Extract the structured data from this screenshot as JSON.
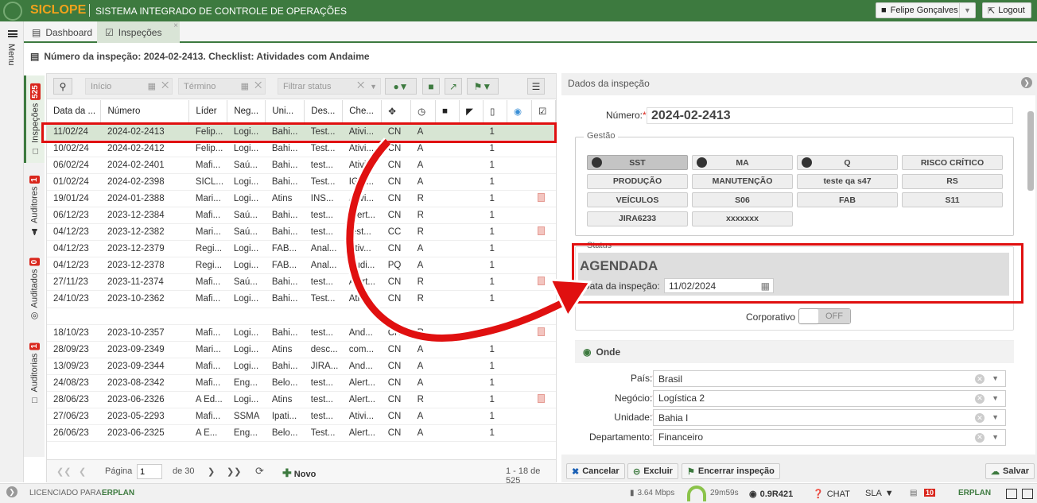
{
  "app": {
    "brand": "SICLOPE",
    "subtitle": "SISTEMA INTEGRADO DE CONTROLE DE OPERAÇÕES",
    "user": "Felipe Gonçalves",
    "logout": "Logout",
    "menu": "Menu"
  },
  "tabs": [
    {
      "label": "Dashboard"
    },
    {
      "label": "Inspeções",
      "close": "×"
    }
  ],
  "breadcrumb": "Número da inspeção: 2024-02-2413. Checklist: Atividades com Andaime",
  "vtabs": [
    {
      "label": "Inspeções",
      "count": "525"
    },
    {
      "label": "Auditores",
      "count": "1"
    },
    {
      "label": "Auditados",
      "count": "0"
    },
    {
      "label": "Auditorias",
      "count": "1"
    }
  ],
  "filters": {
    "start": "Início",
    "end": "Término",
    "status": "Filtrar status"
  },
  "table": {
    "headers": [
      "Data da ...",
      "Número",
      "Líder",
      "Neg...",
      "Uni...",
      "Des...",
      "Che..."
    ],
    "rows": [
      [
        "11/02/24",
        "2024-02-2413",
        "Felip...",
        "Logi...",
        "Bahi...",
        "Test...",
        "Ativi...",
        "CN",
        "A",
        "1"
      ],
      [
        "10/02/24",
        "2024-02-2412",
        "Felip...",
        "Logi...",
        "Bahi...",
        "Test...",
        "Ativi...",
        "CN",
        "A",
        "1"
      ],
      [
        "06/02/24",
        "2024-02-2401",
        "Mafi...",
        "Saú...",
        "Bahi...",
        "test...",
        "Ativi...",
        "CN",
        "A",
        "1"
      ],
      [
        "01/02/24",
        "2024-02-2398",
        "SICL...",
        "Logi...",
        "Bahi...",
        "Test...",
        "IG 7...",
        "CN",
        "A",
        "1"
      ],
      [
        "19/01/24",
        "2024-01-2388",
        "Mari...",
        "Logi...",
        "Atins",
        "INS...",
        "Ativi...",
        "CN",
        "R",
        "1"
      ],
      [
        "06/12/23",
        "2023-12-2384",
        "Mafi...",
        "Saú...",
        "Bahi...",
        "test...",
        "Alert...",
        "CN",
        "R",
        "1"
      ],
      [
        "04/12/23",
        "2023-12-2382",
        "Mari...",
        "Saú...",
        "Bahi...",
        "test...",
        "test...",
        "CC",
        "R",
        "1"
      ],
      [
        "04/12/23",
        "2023-12-2379",
        "Regi...",
        "Logi...",
        "FAB...",
        "Anal...",
        "Ativ...",
        "CN",
        "A",
        "1"
      ],
      [
        "04/12/23",
        "2023-12-2378",
        "Regi...",
        "Logi...",
        "FAB...",
        "Anal...",
        "Audi...",
        "PQ",
        "A",
        "1"
      ],
      [
        "27/11/23",
        "2023-11-2374",
        "Mafi...",
        "Saú...",
        "Bahi...",
        "test...",
        "Alert...",
        "CN",
        "R",
        "1"
      ],
      [
        "24/10/23",
        "2023-10-2362",
        "Mafi...",
        "Logi...",
        "Bahi...",
        "Test...",
        "Ativi...",
        "CN",
        "R",
        "1"
      ],
      [
        "",
        "",
        "",
        "",
        "",
        "",
        "",
        "",
        "",
        ""
      ],
      [
        "18/10/23",
        "2023-10-2357",
        "Mafi...",
        "Logi...",
        "Bahi...",
        "test...",
        "And...",
        "CN",
        "R",
        "1"
      ],
      [
        "28/09/23",
        "2023-09-2349",
        "Mari...",
        "Logi...",
        "Atins",
        "desc...",
        "com...",
        "CN",
        "A",
        "1"
      ],
      [
        "13/09/23",
        "2023-09-2344",
        "Mafi...",
        "Logi...",
        "Bahi...",
        "JIRA...",
        "And...",
        "CN",
        "A",
        "1"
      ],
      [
        "24/08/23",
        "2023-08-2342",
        "Mafi...",
        "Eng...",
        "Belo...",
        "test...",
        "Alert...",
        "CN",
        "A",
        "1"
      ],
      [
        "28/06/23",
        "2023-06-2326",
        "A Ed...",
        "Logi...",
        "Atins",
        "test...",
        "Alert...",
        "CN",
        "R",
        "1"
      ],
      [
        "27/06/23",
        "2023-05-2293",
        "Mafi...",
        "SSMA",
        "Ipati...",
        "test...",
        "Ativi...",
        "CN",
        "A",
        "1"
      ],
      [
        "26/06/23",
        "2023-06-2325",
        "A E...",
        "Eng...",
        "Belo...",
        "Test...",
        "Alert...",
        "CN",
        "A",
        "1"
      ]
    ],
    "pdf_rows": [
      4,
      6,
      9,
      12,
      16
    ]
  },
  "pager": {
    "page_label": "Página",
    "page": "1",
    "of": "de 30",
    "new": "Novo",
    "range": "1 - 18 de 525"
  },
  "detail": {
    "title": "Dados da inspeção",
    "numero_label": "Número:",
    "numero": "2024-02-2413",
    "gestao": "Gestão",
    "gestao_btns": [
      "SST",
      "MA",
      "Q",
      "RISCO CRÍTICO",
      "PRODUÇÃO",
      "MANUTENÇÃO",
      "teste qa s47",
      "RS",
      "VEÍCULOS",
      "S06",
      "FAB",
      "S11",
      "JIRA6233",
      "xxxxxxx"
    ],
    "status_legend": "Status",
    "status": "AGENDADA",
    "date_label": "Data da inspeção:",
    "date": "11/02/2024",
    "corporativo": "Corporativo",
    "toggle": "OFF",
    "onde": "Onde",
    "fields": [
      {
        "label": "País:",
        "value": "Brasil"
      },
      {
        "label": "Negócio:",
        "value": "Logística 2"
      },
      {
        "label": "Unidade:",
        "value": "Bahia I"
      },
      {
        "label": "Departamento:",
        "value": "Financeiro"
      }
    ],
    "btn_cancel": "Cancelar",
    "btn_delete": "Excluir",
    "btn_close": "Encerrar inspeção",
    "btn_save": "Salvar"
  },
  "status": {
    "licensed": "LICENCIADO PARA:",
    "erplan": "ERPLAN",
    "speed": "3.64 Mbps",
    "time": "29m59s",
    "version": "0.9R421",
    "chat": "CHAT",
    "sla": "SLA",
    "notif": "10"
  }
}
